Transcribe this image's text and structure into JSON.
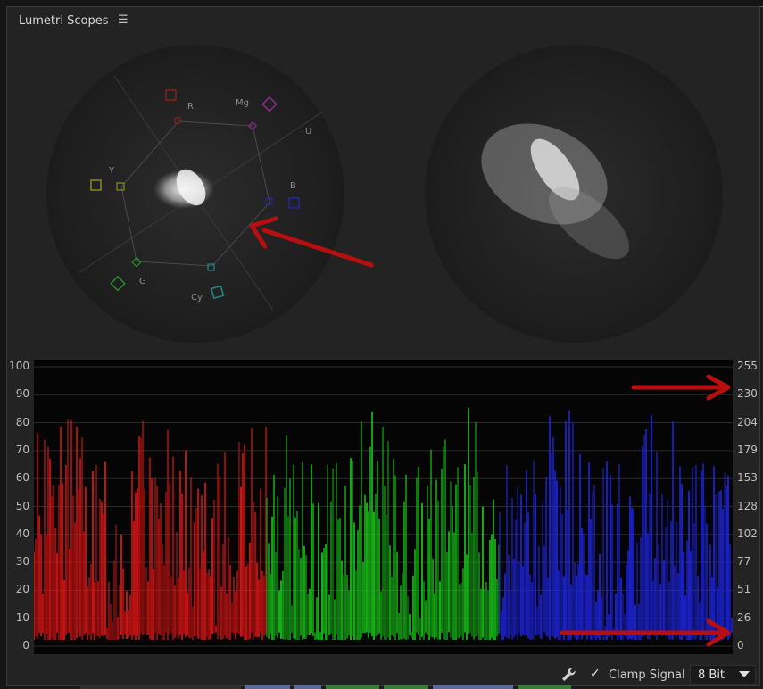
{
  "panel": {
    "title": "Lumetri Scopes",
    "menu_icon": "hamburger-menu-icon"
  },
  "vectorscope_left": {
    "labels": [
      "R",
      "Mg",
      "U",
      "B",
      "Cy",
      "G",
      "Y"
    ],
    "colors": {
      "R": "#8a1f1f",
      "Mg": "#8a2a8a",
      "B": "#1f2a9a",
      "Cy": "#1f8a8a",
      "G": "#2a8a2a",
      "Y": "#8a8a1f"
    }
  },
  "vectorscope_right": {
    "labels": []
  },
  "waveform": {
    "left_ticks": [
      "100",
      "90",
      "80",
      "70",
      "60",
      "50",
      "40",
      "30",
      "20",
      "10",
      "0"
    ],
    "right_ticks": [
      "255",
      "230",
      "204",
      "179",
      "153",
      "128",
      "102",
      "77",
      "51",
      "26",
      "0"
    ],
    "channel_colors": {
      "red": "#e01515",
      "green": "#19c219",
      "blue": "#1d24e0"
    }
  },
  "annotations": {
    "arrow_color": "#b50f0f"
  },
  "bottom_bar": {
    "settings_icon": "wrench-icon",
    "clamp_checked": "✓",
    "clamp_label": "Clamp Signal",
    "bit_depth": "8 Bit"
  }
}
